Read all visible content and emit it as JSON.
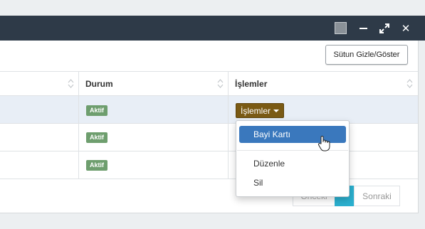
{
  "window": {
    "buttons": {
      "theme_icon": "square-icon",
      "minimize_icon": "minimize-icon",
      "maximize_icon": "expand-icon",
      "close_icon": "close-icon"
    }
  },
  "toolbar": {
    "column_visibility_label": "Sütun Gizle/Göster"
  },
  "table": {
    "columns": [
      {
        "label": "Durum"
      },
      {
        "label": "İşlemler"
      }
    ],
    "rows": [
      {
        "status": "Aktif"
      },
      {
        "status": "Aktif"
      },
      {
        "status": "Aktif"
      }
    ],
    "actions_button_label": "İşlemler"
  },
  "actions_menu": {
    "items": [
      {
        "label": "Bayi Kartı"
      },
      {
        "label": "Düzenle"
      },
      {
        "label": "Sil"
      }
    ]
  },
  "pagination": {
    "previous_label": "Önceki",
    "next_label": "Sonraki"
  },
  "colors": {
    "titlebar": "#2e3a48",
    "badge": "#6e9e6e",
    "actions_button": "#7a5a14",
    "menu_active": "#3a78bd",
    "page_active": "#2bb0cf"
  }
}
